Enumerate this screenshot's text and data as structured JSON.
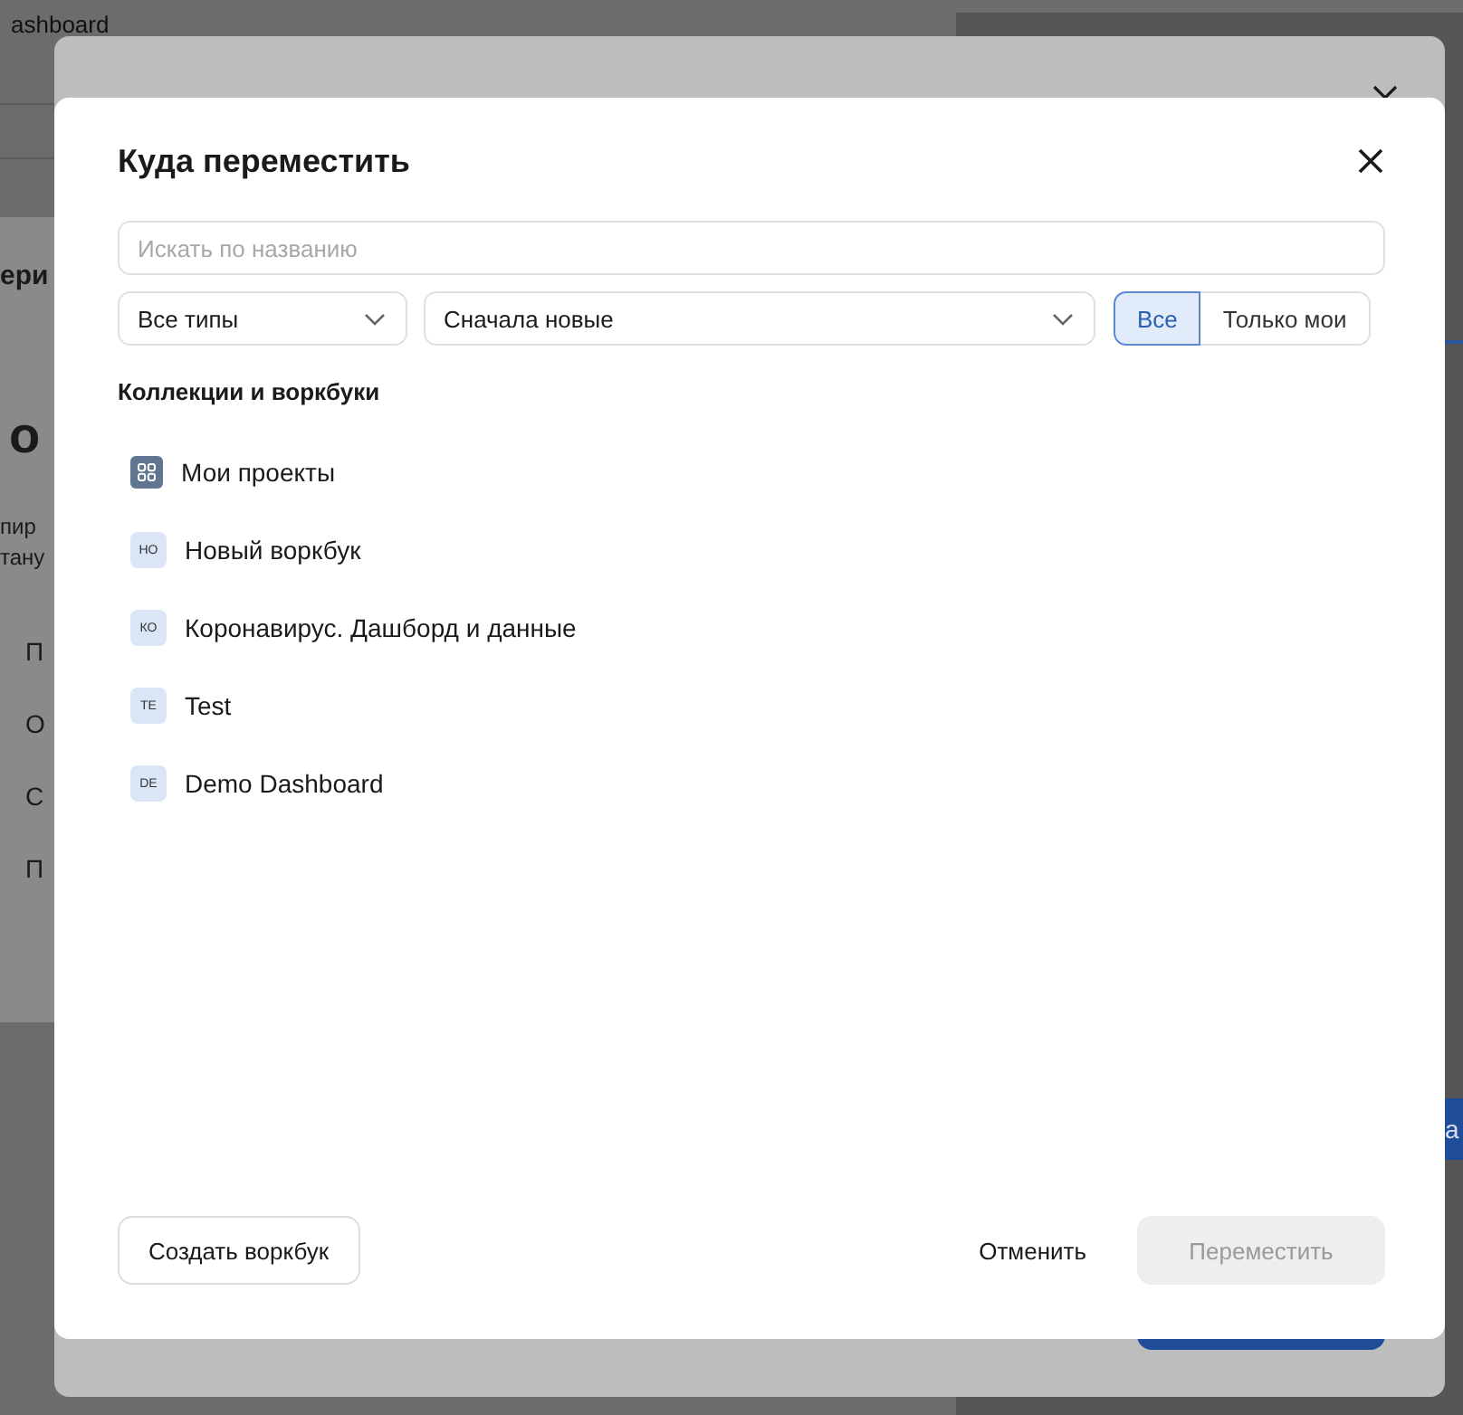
{
  "background_page": {
    "breadcrumb": "ashboard",
    "section_heading": "ери",
    "page_title": "о",
    "description": [
      "пир",
      "тану"
    ],
    "menu_items": [
      "П",
      "О",
      "С",
      "П"
    ],
    "right_button": "а"
  },
  "dialog": {
    "title": "Куда переместить",
    "search": {
      "placeholder": "Искать по названию"
    },
    "type_filter": {
      "value": "Все типы"
    },
    "sort": {
      "value": "Сначала новые"
    },
    "scope": [
      {
        "label": "Все",
        "selected": true
      },
      {
        "label": "Только мои",
        "selected": false
      }
    ],
    "section_label": "Коллекции и воркбуки",
    "items": [
      {
        "kind": "collection",
        "name": "Мои проекты"
      },
      {
        "kind": "workbook",
        "abbr": "НО",
        "name": "Новый воркбук"
      },
      {
        "kind": "workbook",
        "abbr": "КО",
        "name": "Коронавирус. Дашборд и данные"
      },
      {
        "kind": "workbook",
        "abbr": "TE",
        "name": "Test"
      },
      {
        "kind": "workbook",
        "abbr": "DE",
        "name": "Demo Dashboard"
      }
    ],
    "create_button": "Создать воркбук",
    "cancel_button": "Отменить",
    "move_button": {
      "label": "Переместить",
      "disabled": true
    }
  }
}
